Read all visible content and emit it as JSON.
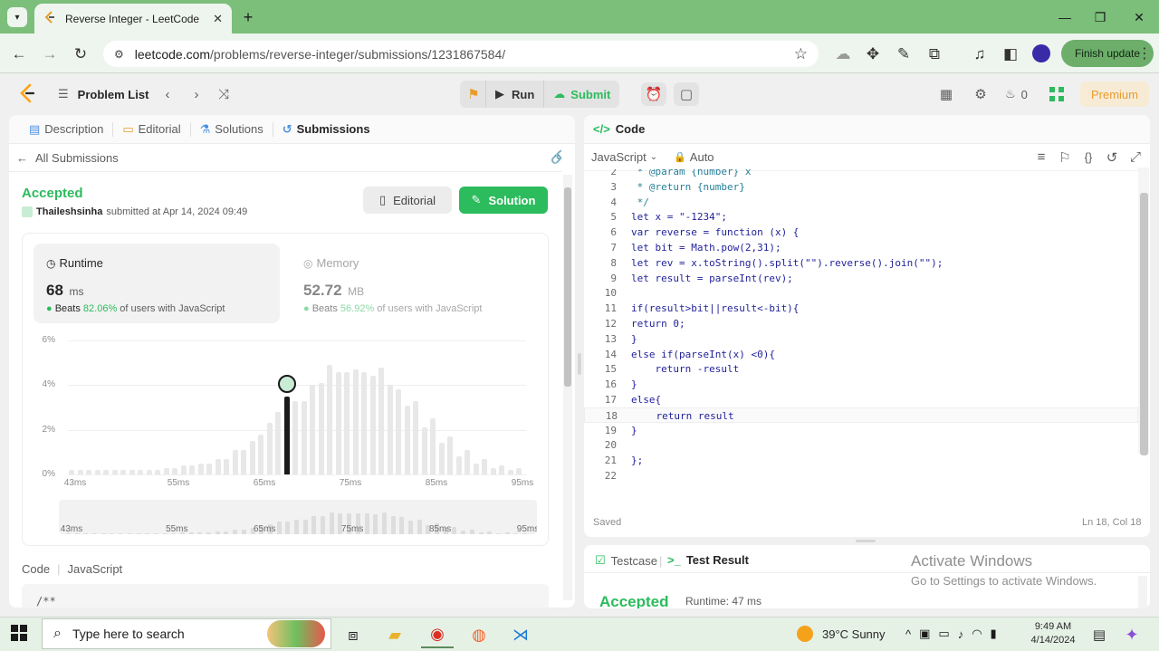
{
  "browser": {
    "tab_title": "Reverse Integer - LeetCode",
    "url_domain": "leetcode.com",
    "url_path": "/problems/reverse-integer/submissions/1231867584/",
    "finish_update": "Finish update",
    "window_controls": [
      "minimize",
      "maximize",
      "close"
    ]
  },
  "nav": {
    "problem_list": "Problem List",
    "run": "Run",
    "submit": "Submit",
    "streak_count": "0",
    "premium": "Premium"
  },
  "left": {
    "tabs": [
      {
        "label": "Description"
      },
      {
        "label": "Editorial"
      },
      {
        "label": "Solutions"
      },
      {
        "label": "Submissions"
      }
    ],
    "all_submissions": "All Submissions",
    "status": "Accepted",
    "user": "Thaileshsinha",
    "submitted_text": "submitted at Apr 14, 2024 09:49",
    "editorial_btn": "Editorial",
    "solution_btn": "Solution",
    "runtime": {
      "label": "Runtime",
      "value": "68",
      "unit": "ms",
      "beats_prefix": "Beats",
      "beats_pct": "82.06%",
      "beats_suffix": "of users with JavaScript"
    },
    "memory": {
      "label": "Memory",
      "value": "52.72",
      "unit": "MB",
      "beats_prefix": "Beats",
      "beats_pct": "56.92%",
      "beats_suffix": "of users with JavaScript"
    },
    "code_label": "Code",
    "code_lang": "JavaScript",
    "code_preview": "/**"
  },
  "chart_data": {
    "type": "bar",
    "y_ticks": [
      "6%",
      "4%",
      "2%",
      "0%"
    ],
    "ylim": [
      0,
      6
    ],
    "x_ticks": [
      "43ms",
      "55ms",
      "65ms",
      "75ms",
      "85ms",
      "95ms"
    ],
    "x": [
      43,
      45,
      47,
      49,
      51,
      53,
      55,
      57,
      59,
      61,
      63,
      65,
      67,
      69,
      71,
      73,
      75,
      77,
      79,
      81,
      83,
      85,
      87,
      89,
      91,
      93,
      95
    ],
    "values": [
      0.2,
      0.2,
      0.2,
      0.2,
      0.2,
      0.2,
      0.3,
      0.4,
      0.5,
      0.7,
      1.1,
      1.8,
      2.8,
      3.3,
      4.0,
      4.9,
      4.6,
      4.6,
      4.8,
      3.8,
      3.3,
      2.5,
      1.7,
      1.1,
      0.7,
      0.4,
      0.3
    ],
    "extra_mid_values": [
      0.2,
      0.2,
      0.2,
      0.2,
      0.2,
      0.3,
      0.4,
      0.5,
      0.7,
      1.1,
      1.5,
      2.3,
      2.9,
      3.3,
      4.1,
      4.6,
      4.7,
      4.4,
      4.0,
      3.1,
      2.1,
      1.4,
      0.8,
      0.5,
      0.3,
      0.2
    ],
    "highlight_x": 68,
    "highlight_value": 3.5,
    "grid": true
  },
  "right": {
    "code_title": "Code",
    "language": "JavaScript",
    "auto": "Auto",
    "lines": [
      {
        "n": "2",
        "t": " * @param {number} x"
      },
      {
        "n": "3",
        "t": " * @return {number}"
      },
      {
        "n": "4",
        "t": " */"
      },
      {
        "n": "5",
        "t": "let x = \"-1234\";"
      },
      {
        "n": "6",
        "t": "var reverse = function (x) {"
      },
      {
        "n": "7",
        "t": "let bit = Math.pow(2,31);"
      },
      {
        "n": "8",
        "t": "let rev = x.toString().split(\"\").reverse().join(\"\");"
      },
      {
        "n": "9",
        "t": "let result = parseInt(rev);"
      },
      {
        "n": "10",
        "t": ""
      },
      {
        "n": "11",
        "t": "if(result>bit||result<-bit){"
      },
      {
        "n": "12",
        "t": "return 0;"
      },
      {
        "n": "13",
        "t": "}"
      },
      {
        "n": "14",
        "t": "else if(parseInt(x) <0){"
      },
      {
        "n": "15",
        "t": "    return -result"
      },
      {
        "n": "16",
        "t": "}"
      },
      {
        "n": "17",
        "t": "else{"
      },
      {
        "n": "18",
        "t": "    return result"
      },
      {
        "n": "19",
        "t": "}"
      },
      {
        "n": "20",
        "t": ""
      },
      {
        "n": "21",
        "t": "};"
      },
      {
        "n": "22",
        "t": ""
      }
    ],
    "saved": "Saved",
    "cursor_pos": "Ln 18, Col 18",
    "testcase": "Testcase",
    "test_result": "Test Result",
    "result_status": "Accepted",
    "result_runtime": "Runtime: 47 ms",
    "activate_title": "Activate Windows",
    "activate_sub": "Go to Settings to activate Windows."
  },
  "taskbar": {
    "search_placeholder": "Type here to search",
    "weather": "39°C  Sunny",
    "time": "9:49 AM",
    "date": "4/14/2024"
  },
  "colors": {
    "accent_green": "#2cbb5d",
    "browser_green": "#7bbf7a",
    "premium_orange": "#e89c2c"
  }
}
